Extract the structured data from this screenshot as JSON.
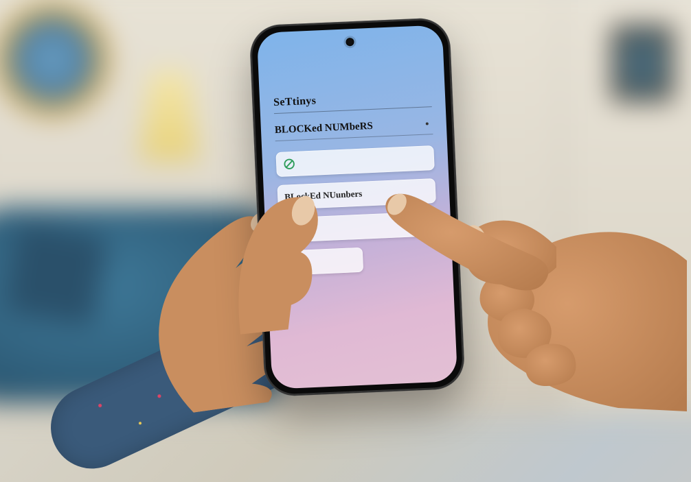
{
  "phone": {
    "settings_heading": "SeTtinys",
    "section_heading": "BLOCKed NUMbeRS",
    "rows": [
      {
        "label": "",
        "icon": "block-icon"
      },
      {
        "label": "BLockEd NUunbers",
        "icon": null
      },
      {
        "label": "",
        "icon": "block-icon"
      },
      {
        "label": "",
        "icon": "gear-icon"
      }
    ]
  },
  "colors": {
    "icon_green": "#2e9d5a",
    "icon_teal": "#2a9d8f"
  }
}
